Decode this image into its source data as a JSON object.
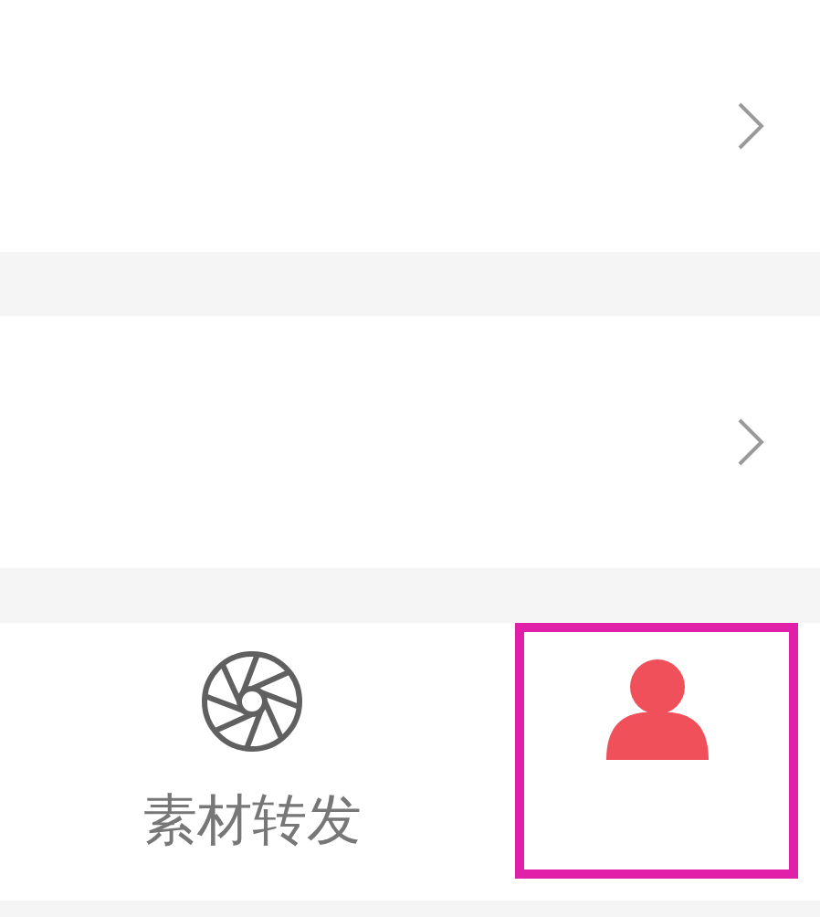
{
  "list_rows": [
    {
      "kind": "chevron"
    },
    {
      "kind": "chevron"
    }
  ],
  "tab_bar": [
    {
      "kind": "aperture",
      "label": "素材转发",
      "selected": false,
      "highlighted": false
    },
    {
      "kind": "person",
      "selected": true,
      "highlighted": true
    }
  ]
}
